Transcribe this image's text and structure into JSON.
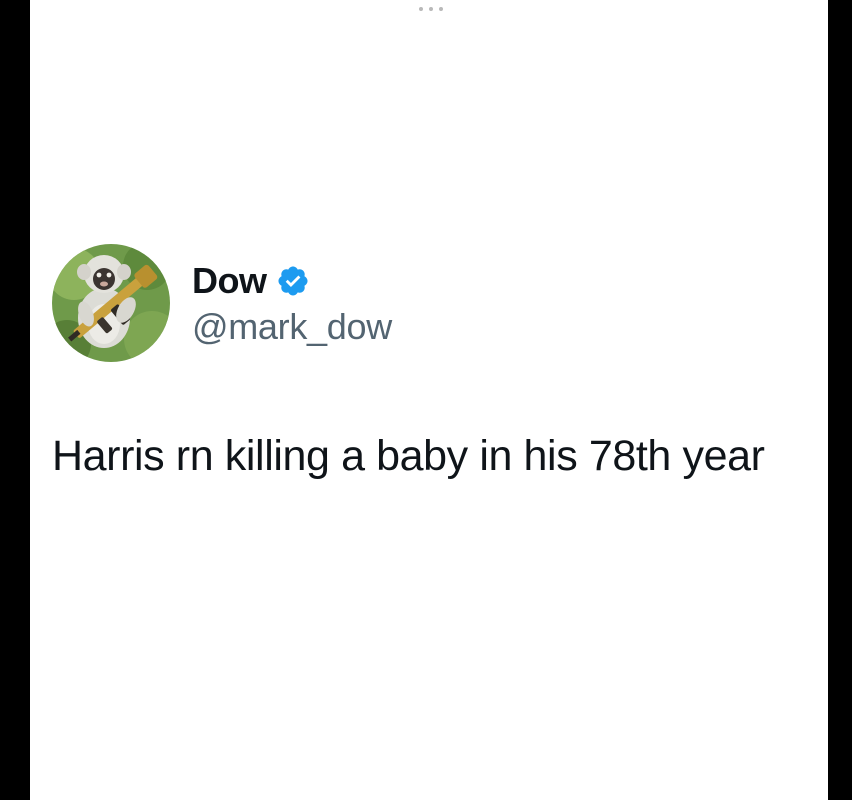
{
  "tweet": {
    "author": {
      "display_name": "Dow",
      "handle": "@mark_dow",
      "verified": true,
      "avatar": "monkey-with-rifle-avatar"
    },
    "text": "Harris rn killing a baby in his 78th year"
  },
  "icons": {
    "more": "more-dots-icon",
    "verified": "verified-badge-icon"
  },
  "colors": {
    "verified_blue": "#1d9bf0",
    "name_text": "#0f1419",
    "handle_text": "#536471",
    "background": "#ffffff",
    "side_bars": "#000000"
  }
}
